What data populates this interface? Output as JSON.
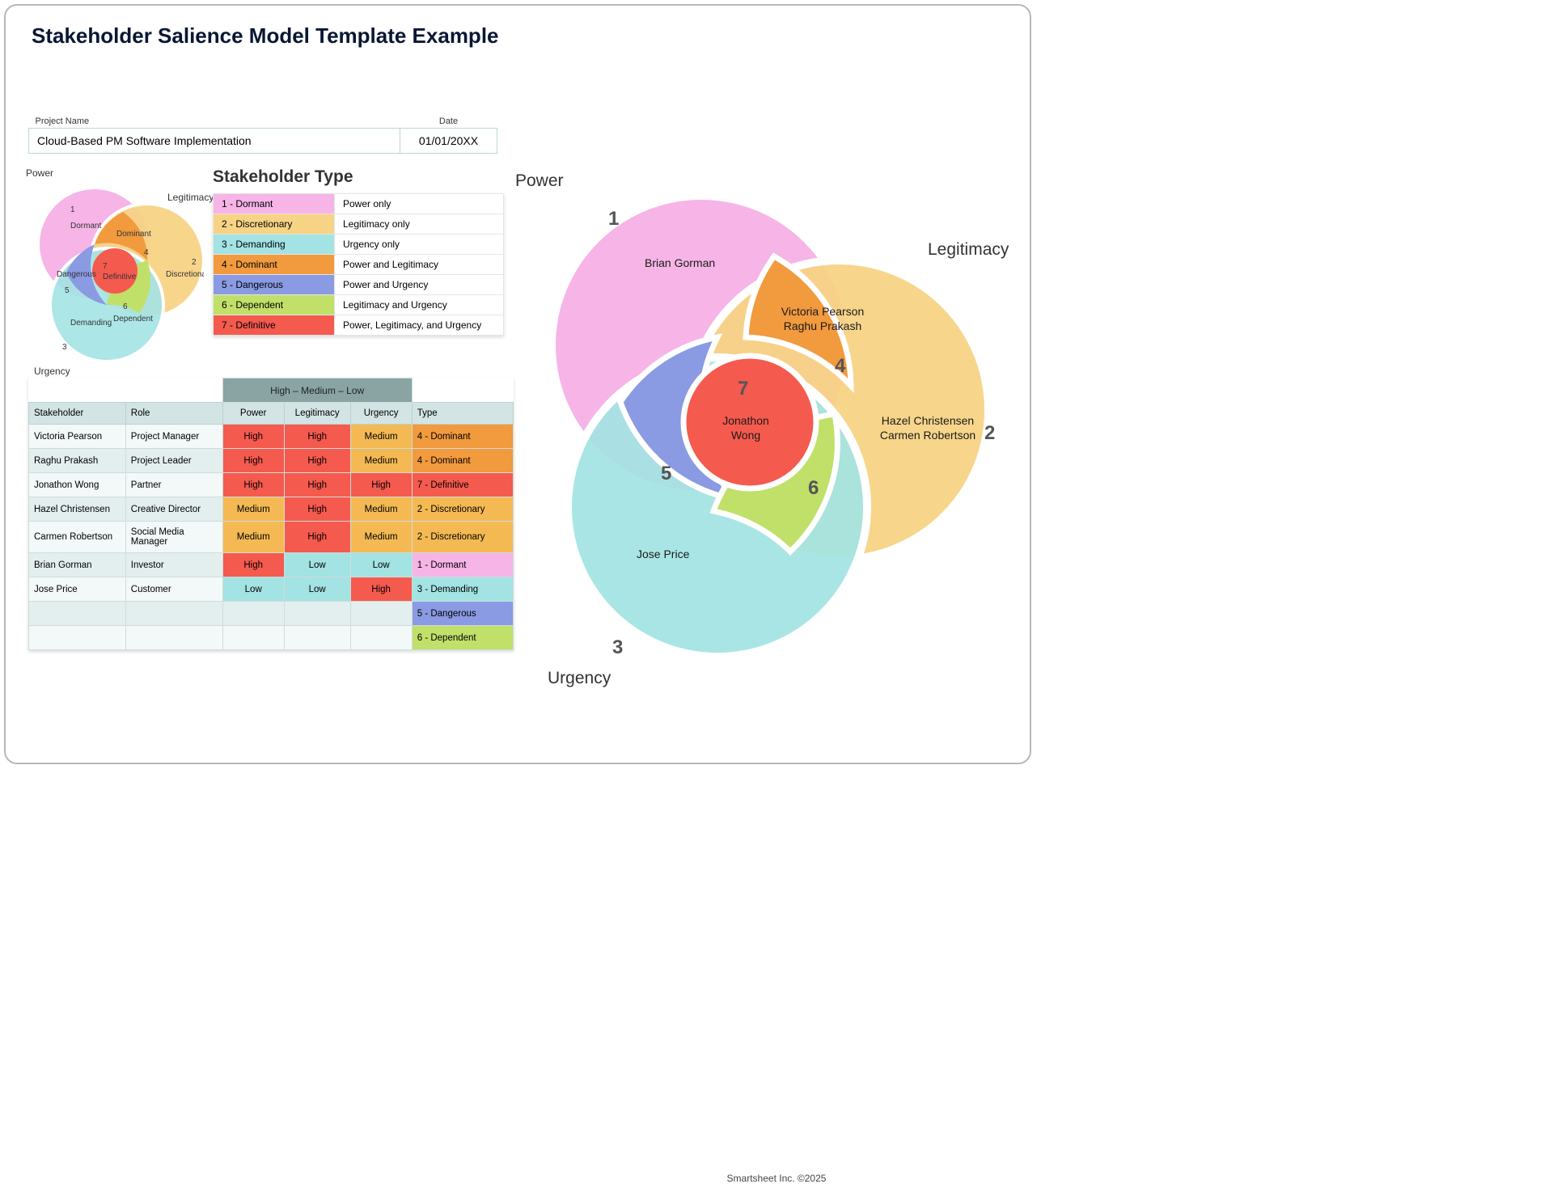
{
  "title": "Stakeholder Salience Model Template Example",
  "footer": "Smartsheet Inc. ©2025",
  "project": {
    "name_header": "Project Name",
    "date_header": "Date",
    "name": "Cloud-Based PM Software Implementation",
    "date": "01/01/20XX"
  },
  "type_header": "Stakeholder Type",
  "types": [
    {
      "num": "1",
      "name": "Dormant",
      "desc": "Power only",
      "color": "#f6b4e7"
    },
    {
      "num": "2",
      "name": "Discretionary",
      "desc": "Legitimacy only",
      "color": "#f7d385"
    },
    {
      "num": "3",
      "name": "Demanding",
      "desc": "Urgency only",
      "color": "#a3e3e3"
    },
    {
      "num": "4",
      "name": "Dominant",
      "desc": "Power and Legitimacy",
      "color": "#f19a3e"
    },
    {
      "num": "5",
      "name": "Dangerous",
      "desc": "Power and Urgency",
      "color": "#8a9ae3"
    },
    {
      "num": "6",
      "name": "Dependent",
      "desc": "Legitimacy and Urgency",
      "color": "#c0e06a"
    },
    {
      "num": "7",
      "name": "Definitive",
      "desc": "Power, Legitimacy, and Urgency",
      "color": "#f55a4e"
    }
  ],
  "axes": {
    "power": "Power",
    "legitimacy": "Legitimacy",
    "urgency": "Urgency"
  },
  "rating_caption": "High  –  Medium  –  Low",
  "headers": {
    "stakeholder": "Stakeholder",
    "role": "Role",
    "power": "Power",
    "legitimacy": "Legitimacy",
    "urgency": "Urgency",
    "type": "Type"
  },
  "rows": [
    {
      "stakeholder": "Victoria Pearson",
      "role": "Project Manager",
      "power": "High",
      "legitimacy": "High",
      "urgency": "Medium",
      "type": "4 - Dominant",
      "tc": "4"
    },
    {
      "stakeholder": "Raghu Prakash",
      "role": "Project Leader",
      "power": "High",
      "legitimacy": "High",
      "urgency": "Medium",
      "type": "4 - Dominant",
      "tc": "4"
    },
    {
      "stakeholder": "Jonathon Wong",
      "role": "Partner",
      "power": "High",
      "legitimacy": "High",
      "urgency": "High",
      "type": "7 - Definitive",
      "tc": "7"
    },
    {
      "stakeholder": "Hazel Christensen",
      "role": "Creative Director",
      "power": "Medium",
      "legitimacy": "High",
      "urgency": "Medium",
      "type": "2 - Discretionary",
      "tc": "2"
    },
    {
      "stakeholder": "Carmen Robertson",
      "role": "Social Media Manager",
      "power": "Medium",
      "legitimacy": "High",
      "urgency": "Medium",
      "type": "2 - Discretionary",
      "tc": "2"
    },
    {
      "stakeholder": "Brian Gorman",
      "role": "Investor",
      "power": "High",
      "legitimacy": "Low",
      "urgency": "Low",
      "type": "1 - Dormant",
      "tc": "1"
    },
    {
      "stakeholder": "Jose Price",
      "role": "Customer",
      "power": "Low",
      "legitimacy": "Low",
      "urgency": "High",
      "type": "3 - Demanding",
      "tc": "3"
    },
    {
      "stakeholder": "",
      "role": "",
      "power": "",
      "legitimacy": "",
      "urgency": "",
      "type": "5 - Dangerous",
      "tc": "5"
    },
    {
      "stakeholder": "",
      "role": "",
      "power": "",
      "legitimacy": "",
      "urgency": "",
      "type": "6 - Dependent",
      "tc": "6"
    }
  ],
  "venn_names": {
    "r1": "Brian Gorman",
    "r2a": "Hazel Christensen",
    "r2b": "Carmen Robertson",
    "r3": "Jose Price",
    "r4a": "Victoria Pearson",
    "r4b": "Raghu Prakash",
    "r7a": "Jonathon",
    "r7b": "Wong"
  },
  "chart_data": {
    "type": "venn3",
    "sets": [
      "Power",
      "Legitimacy",
      "Urgency"
    ],
    "regions": [
      {
        "region": 1,
        "sets": [
          "Power"
        ],
        "label": "Dormant",
        "members": [
          "Brian Gorman"
        ]
      },
      {
        "region": 2,
        "sets": [
          "Legitimacy"
        ],
        "label": "Discretionary",
        "members": [
          "Hazel Christensen",
          "Carmen Robertson"
        ]
      },
      {
        "region": 3,
        "sets": [
          "Urgency"
        ],
        "label": "Demanding",
        "members": [
          "Jose Price"
        ]
      },
      {
        "region": 4,
        "sets": [
          "Power",
          "Legitimacy"
        ],
        "label": "Dominant",
        "members": [
          "Victoria Pearson",
          "Raghu Prakash"
        ]
      },
      {
        "region": 5,
        "sets": [
          "Power",
          "Urgency"
        ],
        "label": "Dangerous",
        "members": []
      },
      {
        "region": 6,
        "sets": [
          "Legitimacy",
          "Urgency"
        ],
        "label": "Dependent",
        "members": []
      },
      {
        "region": 7,
        "sets": [
          "Power",
          "Legitimacy",
          "Urgency"
        ],
        "label": "Definitive",
        "members": [
          "Jonathon Wong"
        ]
      }
    ]
  }
}
